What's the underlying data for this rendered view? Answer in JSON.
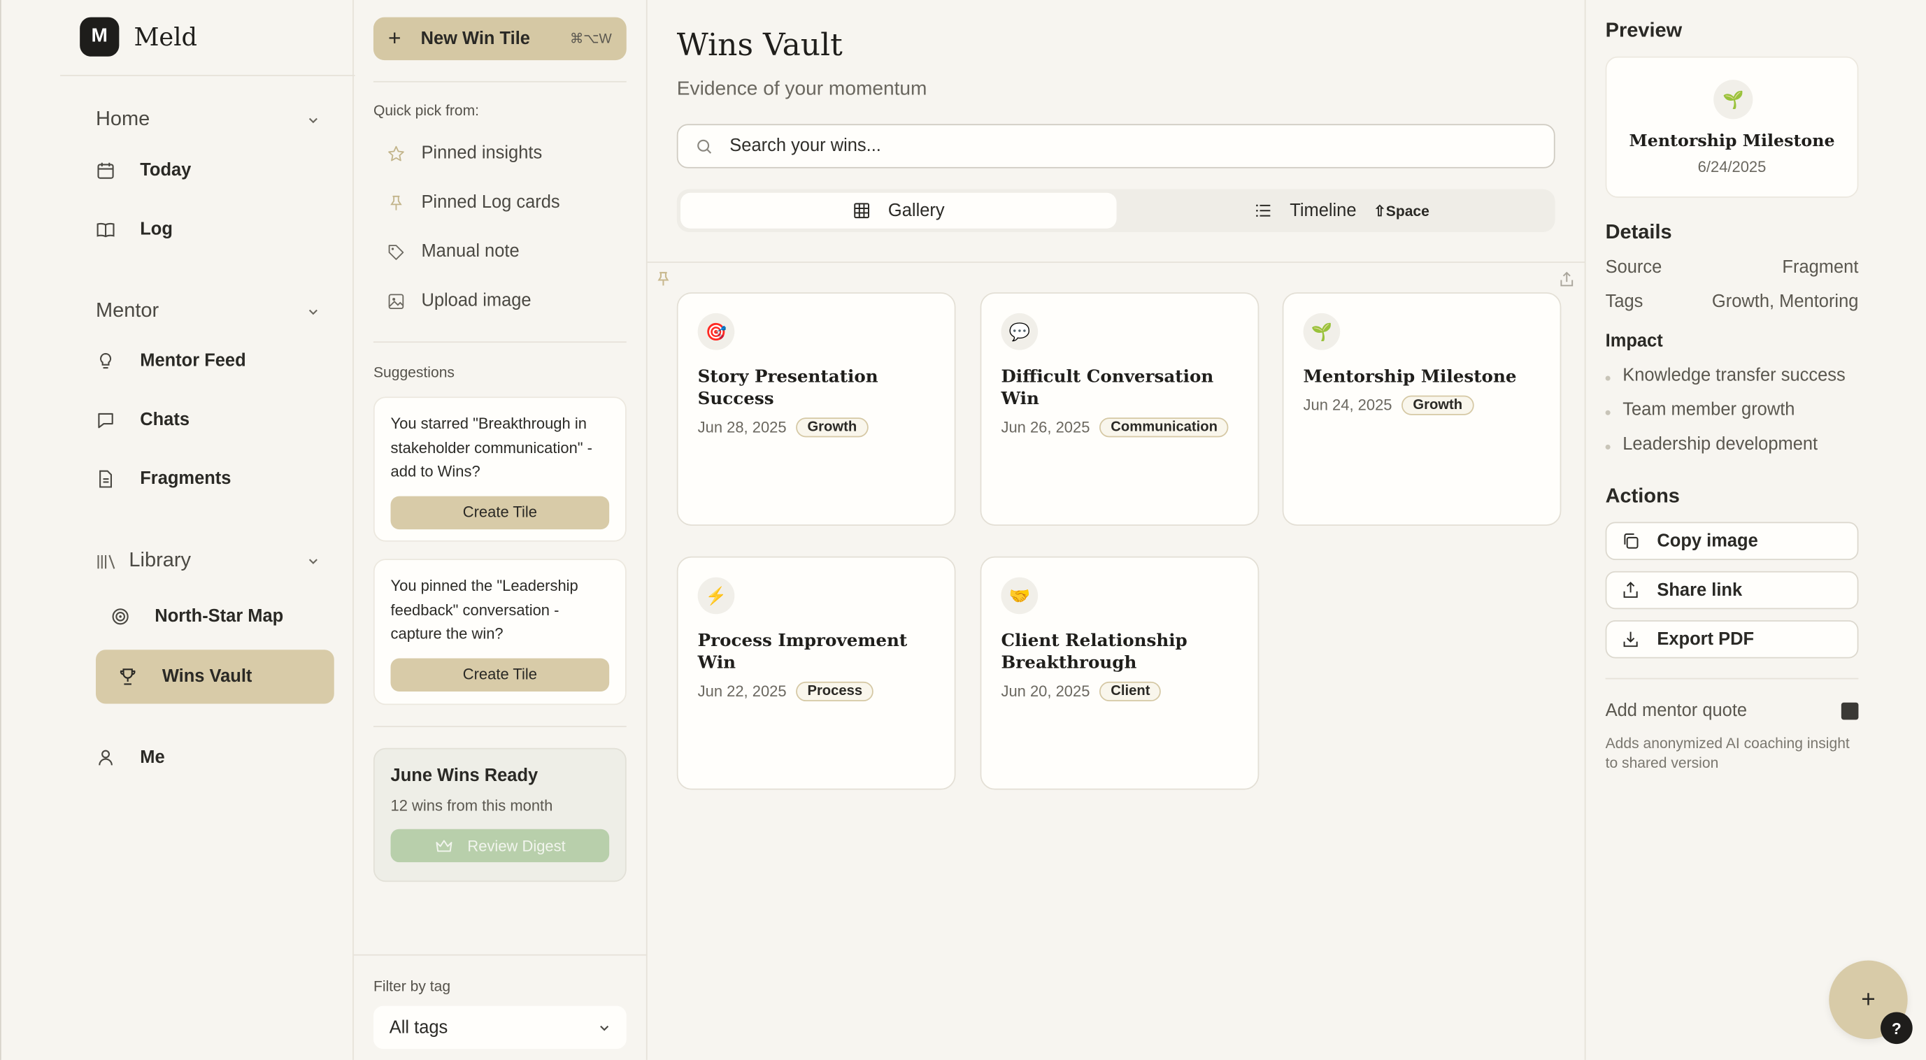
{
  "brand": {
    "logo_letter": "M",
    "name": "Meld"
  },
  "nav": {
    "home": {
      "label": "Home",
      "items": [
        "Today",
        "Log"
      ]
    },
    "mentor": {
      "label": "Mentor",
      "items": [
        "Mentor Feed",
        "Chats",
        "Fragments"
      ]
    },
    "library": {
      "label": "Library",
      "items": [
        "North-Star Map",
        "Wins Vault"
      ]
    },
    "me": "Me",
    "active": "Wins Vault"
  },
  "col2": {
    "new_tile": {
      "label": "New Win Tile",
      "shortcut": "⌘⌥W"
    },
    "quick_pick_label": "Quick pick from:",
    "quick_pick": [
      "Pinned insights",
      "Pinned Log cards",
      "Manual note",
      "Upload image"
    ],
    "suggestions_label": "Suggestions",
    "suggestions": [
      {
        "text": "You starred \"Breakthrough in stakeholder communication\" - add to Wins?",
        "button": "Create Tile"
      },
      {
        "text": "You pinned the \"Leadership feedback\" conversation - capture the win?",
        "button": "Create Tile"
      }
    ],
    "digest": {
      "title": "June Wins Ready",
      "subtitle": "12 wins from this month",
      "button": "Review Digest"
    },
    "filter": {
      "label": "Filter by tag",
      "value": "All tags"
    }
  },
  "main": {
    "title": "Wins Vault",
    "subtitle": "Evidence of your momentum",
    "search_placeholder": "Search your wins...",
    "view_toggle": {
      "gallery": "Gallery",
      "timeline": "Timeline",
      "timeline_key": "⇧Space",
      "selected": "Gallery"
    },
    "cards": [
      {
        "icon": "🎯",
        "title": "Story Presentation Success",
        "date": "Jun 28, 2025",
        "tag": "Growth"
      },
      {
        "icon": "💬",
        "title": "Difficult Conversation Win",
        "date": "Jun 26, 2025",
        "tag": "Communication"
      },
      {
        "icon": "🌱",
        "title": "Mentorship Milestone",
        "date": "Jun 24, 2025",
        "tag": "Growth"
      },
      {
        "icon": "⚡",
        "title": "Process Improvement Win",
        "date": "Jun 22, 2025",
        "tag": "Process"
      },
      {
        "icon": "🤝",
        "title": "Client Relationship Breakthrough",
        "date": "Jun 20, 2025",
        "tag": "Client"
      }
    ]
  },
  "right": {
    "preview_label": "Preview",
    "preview": {
      "icon": "🌱",
      "title": "Mentorship Milestone",
      "date": "6/24/2025"
    },
    "details_label": "Details",
    "details": [
      {
        "key": "Source",
        "value": "Fragment"
      },
      {
        "key": "Tags",
        "value": "Growth, Mentoring"
      }
    ],
    "impact_label": "Impact",
    "impact": [
      "Knowledge transfer success",
      "Team member growth",
      "Leadership development"
    ],
    "actions_label": "Actions",
    "actions": [
      "Copy image",
      "Share link",
      "Export PDF"
    ],
    "mentor_quote": {
      "label": "Add mentor quote",
      "checked": true,
      "description": "Adds anonymized AI coaching insight to shared version"
    }
  },
  "fab": {
    "label": "+"
  },
  "help": {
    "label": "?"
  }
}
